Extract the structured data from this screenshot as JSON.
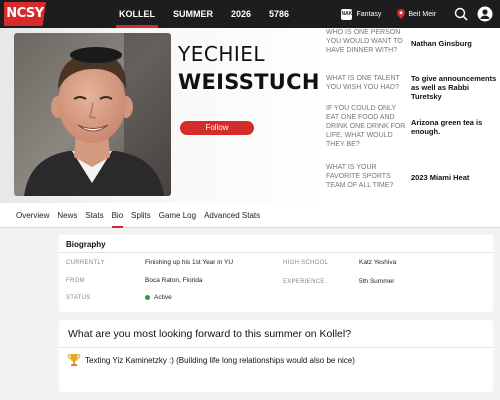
{
  "logo": {
    "text": "NCSY"
  },
  "nav": {
    "links": [
      "KOLLEL",
      "SUMMER",
      "2026",
      "5786"
    ],
    "active_index": 0,
    "fantasy_label": "Fantasy",
    "fantasy_badge": "NAK",
    "location_label": "Beit Meir"
  },
  "player": {
    "first_name": "YECHIEL",
    "last_name": "WEISSTUCH",
    "follow_label": "Follow"
  },
  "qa": [
    {
      "question": "WHO IS ONE PERSON YOU WOULD WANT TO HAVE DINNER WITH?",
      "answer": "Nathan Ginsburg"
    },
    {
      "question": "WHAT IS ONE TALENT YOU WISH YOU HAD?",
      "answer": "To give announcements as well as Rabbi Turetsky"
    },
    {
      "question": "IF YOU COULD ONLY EAT ONE FOOD AND DRINK ONE DRINK FOR LIFE, WHAT WOULD THEY BE?",
      "answer": "Arizona green tea is enough."
    },
    {
      "question": "WHAT IS YOUR FAVORITE SPORTS TEAM OF ALL TIME?",
      "answer": "2023 Miami Heat"
    }
  ],
  "tabs": [
    "Overview",
    "News",
    "Stats",
    "Bio",
    "Splits",
    "Game Log",
    "Advanced Stats"
  ],
  "active_tab": "Bio",
  "bio": {
    "title": "Biography",
    "currently_label": "CURRENTLY",
    "currently_value": "Finishing up his 1st Year in YU",
    "from_label": "FROM",
    "from_value": "Boca Raton, Florida",
    "status_label": "STATUS",
    "status_value": "Active",
    "highschool_label": "HIGH SCHOOL",
    "highschool_value": "Katz Yeshiva",
    "experience_label": "EXPERIENCE",
    "experience_value": "5th Summer"
  },
  "question_card": {
    "title": "What are you most looking forward to this summer on Kollel?",
    "answer": "Texting Yiz Kaminetzky :) (Building life long relationships would also be nice)"
  },
  "colors": {
    "accent": "#d42b2b",
    "nav_bg": "#1d1d1f",
    "status_active": "#2a9d3a"
  }
}
